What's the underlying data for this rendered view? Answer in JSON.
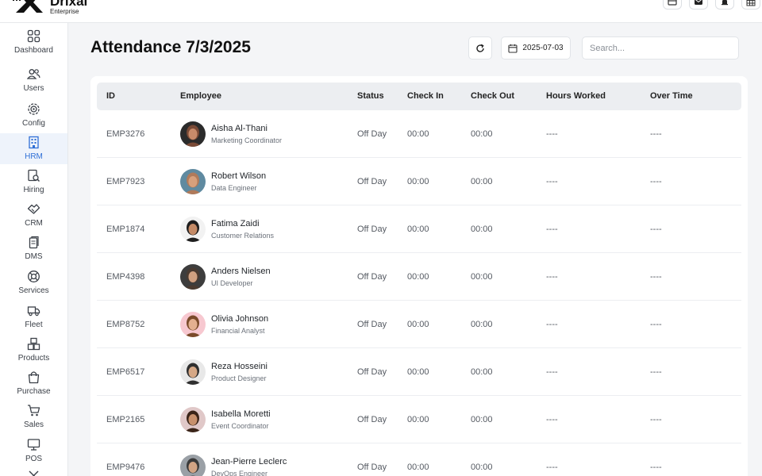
{
  "brand": {
    "name": "Drixal",
    "sub": "Enterprise"
  },
  "top_icons": [
    "window-icon",
    "mail-icon",
    "bell-icon",
    "grid-icon"
  ],
  "sidebar": {
    "items": [
      {
        "label": "Dashboard",
        "icon": "dashboard-icon"
      },
      {
        "label": "Users",
        "icon": "users-icon"
      },
      {
        "label": "Config",
        "icon": "gear-icon"
      },
      {
        "label": "HRM",
        "icon": "building-icon",
        "active": true
      },
      {
        "label": "Hiring",
        "icon": "hiring-icon"
      },
      {
        "label": "CRM",
        "icon": "handshake-icon"
      },
      {
        "label": "DMS",
        "icon": "document-icon"
      },
      {
        "label": "Services",
        "icon": "lifebuoy-icon"
      },
      {
        "label": "Fleet",
        "icon": "truck-icon"
      },
      {
        "label": "Products",
        "icon": "boxes-icon"
      },
      {
        "label": "Purchase",
        "icon": "bag-icon"
      },
      {
        "label": "Sales",
        "icon": "cart-icon"
      },
      {
        "label": "POS",
        "icon": "monitor-icon"
      }
    ]
  },
  "page": {
    "title": "Attendance 7/3/2025"
  },
  "toolbar": {
    "date_value": "2025-07-03",
    "search_placeholder": "Search..."
  },
  "table": {
    "columns": [
      "ID",
      "Employee",
      "Status",
      "Check In",
      "Check Out",
      "Hours Worked",
      "Over Time"
    ],
    "rows": [
      {
        "id": "EMP3276",
        "name": "Aisha Al-Thani",
        "role": "Marketing Coordinator",
        "status": "Off Day",
        "check_in": "00:00",
        "check_out": "00:00",
        "hours": "----",
        "overtime": "----"
      },
      {
        "id": "EMP7923",
        "name": "Robert Wilson",
        "role": "Data Engineer",
        "status": "Off Day",
        "check_in": "00:00",
        "check_out": "00:00",
        "hours": "----",
        "overtime": "----"
      },
      {
        "id": "EMP1874",
        "name": "Fatima Zaidi",
        "role": "Customer Relations",
        "status": "Off Day",
        "check_in": "00:00",
        "check_out": "00:00",
        "hours": "----",
        "overtime": "----"
      },
      {
        "id": "EMP4398",
        "name": "Anders Nielsen",
        "role": "UI Developer",
        "status": "Off Day",
        "check_in": "00:00",
        "check_out": "00:00",
        "hours": "----",
        "overtime": "----"
      },
      {
        "id": "EMP8752",
        "name": "Olivia Johnson",
        "role": "Financial Analyst",
        "status": "Off Day",
        "check_in": "00:00",
        "check_out": "00:00",
        "hours": "----",
        "overtime": "----"
      },
      {
        "id": "EMP6517",
        "name": "Reza Hosseini",
        "role": "Product Designer",
        "status": "Off Day",
        "check_in": "00:00",
        "check_out": "00:00",
        "hours": "----",
        "overtime": "----"
      },
      {
        "id": "EMP2165",
        "name": "Isabella Moretti",
        "role": "Event Coordinator",
        "status": "Off Day",
        "check_in": "00:00",
        "check_out": "00:00",
        "hours": "----",
        "overtime": "----"
      },
      {
        "id": "EMP9476",
        "name": "Jean-Pierre Leclerc",
        "role": "DevOps Engineer",
        "status": "Off Day",
        "check_in": "00:00",
        "check_out": "00:00",
        "hours": "----",
        "overtime": "----"
      }
    ]
  },
  "colors": {
    "accent": "#2f6fd6",
    "background": "#f4f5f7",
    "header_row": "#eceef1"
  }
}
